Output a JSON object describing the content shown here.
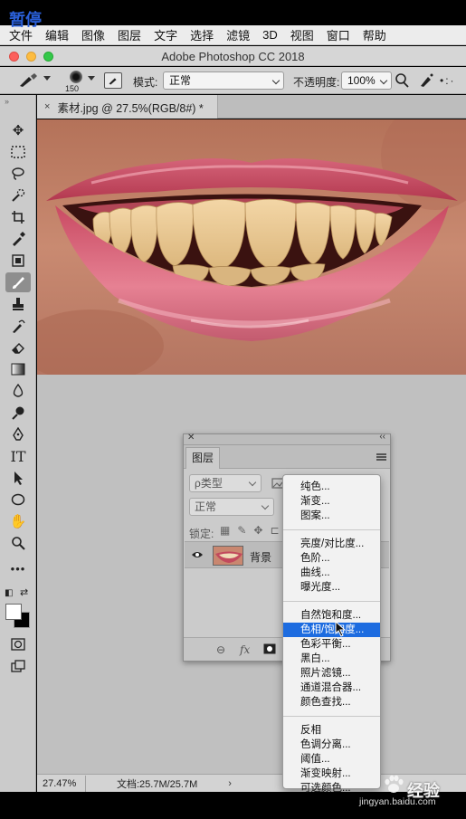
{
  "overlay": {
    "pause_label": "暂停"
  },
  "menubar": {
    "items": [
      "文件",
      "编辑",
      "图像",
      "图层",
      "文字",
      "选择",
      "滤镜",
      "3D",
      "视图",
      "窗口",
      "帮助"
    ]
  },
  "window": {
    "title": "Adobe Photoshop CC 2018"
  },
  "options_bar": {
    "brush_size": "150",
    "mode_label": "模式:",
    "mode_value": "正常",
    "opacity_label": "不透明度:",
    "opacity_value": "100%"
  },
  "document": {
    "tab_title": "素材.jpg @ 27.5%(RGB/8#) *",
    "tab_close": "×"
  },
  "statusbar": {
    "zoom": "27.47%",
    "doc_info": "文档:25.7M/25.7M",
    "arrow": "›"
  },
  "layers_panel": {
    "tab_label": "图层",
    "filter_kind": "ρ类型",
    "blend_mode": "正常",
    "lock_label": "锁定:",
    "layer_name": "背景",
    "footer_link": "⊖",
    "footer_fx": "fx"
  },
  "adjustment_menu": {
    "groups": [
      [
        "纯色...",
        "渐变...",
        "图案..."
      ],
      [
        "亮度/对比度...",
        "色阶...",
        "曲线...",
        "曝光度..."
      ],
      [
        "自然饱和度...",
        "色相/饱和度...",
        "色彩平衡...",
        "黑白...",
        "照片滤镜...",
        "通道混合器...",
        "颜色查找..."
      ],
      [
        "反相",
        "色调分离...",
        "阈值...",
        "渐变映射...",
        "可选颜色..."
      ]
    ],
    "selected": "色相/饱和度..."
  },
  "watermark": {
    "text": "经验",
    "url": "jingyan.baidu.com"
  },
  "colors": {
    "selection_blue": "#1d6ce0",
    "foreground": "#ffffff",
    "background": "#000000"
  }
}
